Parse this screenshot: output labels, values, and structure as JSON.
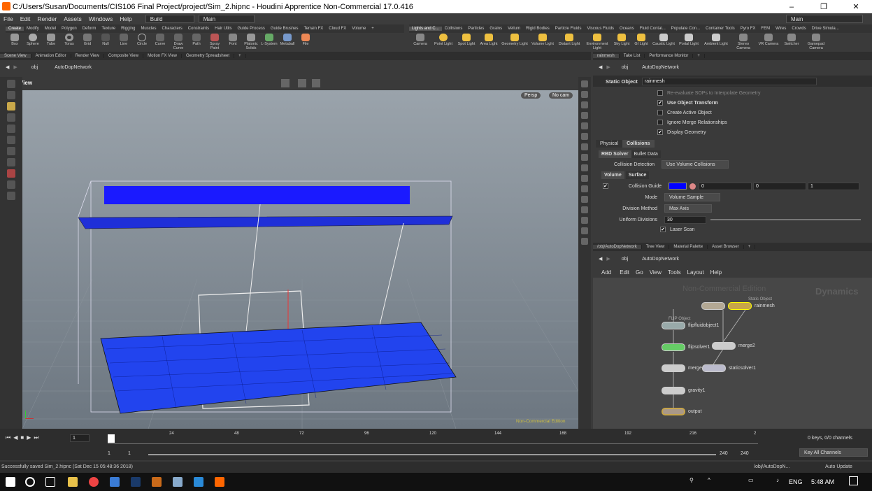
{
  "window": {
    "title": "C:/Users/Susan/Documents/CIS106 Final Project/project/Sim_2.hipnc - Houdini Apprentice Non-Commercial 17.0.416",
    "min": "–",
    "max": "❐",
    "close": "✕"
  },
  "menu": {
    "items": [
      "File",
      "Edit",
      "Render",
      "Assets",
      "Windows",
      "Help"
    ],
    "build": "Build",
    "main": "Main",
    "main_right": "Main"
  },
  "shelf_left": {
    "tabs": [
      "Create",
      "Modify",
      "Model",
      "Polygon",
      "Deform",
      "Texture",
      "Rigging",
      "Muscles",
      "Characters",
      "Constraints",
      "Hair Utils",
      "Guide Process",
      "Guide Brushes",
      "Terrain FX",
      "Cloud FX",
      "Volume"
    ],
    "tools": [
      "Box",
      "Sphere",
      "Tube",
      "Torus",
      "Grid",
      "Null",
      "Line",
      "Circle",
      "Curve",
      "Draw Curve",
      "Path",
      "Spray Paint",
      "Font",
      "Platonic Solids",
      "L-System",
      "Metaball",
      "File"
    ]
  },
  "shelf_right": {
    "tabs": [
      "Lights and C...",
      "Collisions",
      "Particles",
      "Grains",
      "Vellum",
      "Rigid Bodies",
      "Particle Fluids",
      "Viscous Fluids",
      "Oceans",
      "Fluid Contai...",
      "Populate Con...",
      "Container Tools",
      "Pyro FX",
      "FEM",
      "Wires",
      "Crowds",
      "Drive Simula..."
    ],
    "tools": [
      "Camera",
      "Point Light",
      "Spot Light",
      "Area Light",
      "Geometry Light",
      "Volume Light",
      "Distant Light",
      "Environment Light",
      "Sky Light",
      "GI Light",
      "Caustic Light",
      "Portal Light",
      "Ambient Light",
      "Stereo Camera",
      "VR Camera",
      "Switcher",
      "Gamepad Camera"
    ]
  },
  "left_tabs": [
    "Scene View",
    "Animation Editor",
    "Render View",
    "Composite View",
    "Motion FX View",
    "Geometry Spreadsheet"
  ],
  "right_tabs_top": [
    "rainmesh",
    "Take List",
    "Performance Monitor"
  ],
  "path": {
    "obj": "obj",
    "net": "AutoDopNetwork"
  },
  "viewport": {
    "label": "View",
    "persp": "Persp",
    "cam": "No cam",
    "watermark": "Non-Commercial Edition"
  },
  "params": {
    "type": "Static Object",
    "name": "rainmesh",
    "toggles": [
      {
        "label": "Re-evaluate SOPs to Interpolate Geometry",
        "on": false
      },
      {
        "label": "Use Object Transform",
        "on": true
      },
      {
        "label": "Create Active Object",
        "on": false
      },
      {
        "label": "Ignore Merge Relationships",
        "on": false
      },
      {
        "label": "Display Geometry",
        "on": true
      }
    ],
    "tabs": [
      "Physical",
      "Collisions"
    ],
    "subtabs": [
      "RBD Solver",
      "Bullet Data"
    ],
    "collision_detection_label": "Collision Detection",
    "collision_detection": "Use Volume Collisions",
    "vs_tabs": [
      "Volume",
      "Surface"
    ],
    "guide_label": "Collision Guide",
    "guide_values": [
      "0",
      "0",
      "1"
    ],
    "guide_color": "#0000ff",
    "mode_label": "Mode",
    "mode": "Volume Sample",
    "division_label": "Division Method",
    "division": "Max Axis",
    "uniform_label": "Uniform Divisions",
    "uniform": "30",
    "laser": "Laser Scan"
  },
  "net_tabs": [
    "/obj/AutoDopNetwork",
    "Tree View",
    "Material Palette",
    "Asset Browser"
  ],
  "net_menu": [
    "Add",
    "Edit",
    "Go",
    "View",
    "Tools",
    "Layout",
    "Help"
  ],
  "network": {
    "watermark": "Non-Commercial Edition",
    "context": "Dynamics",
    "nodes": [
      {
        "name": "rainmesh",
        "sub": "Static Object"
      },
      {
        "name": "flipfluidobject1",
        "sub": "FLIP Object"
      },
      {
        "name": "flipsolver1",
        "sub": ""
      },
      {
        "name": "merge2",
        "sub": ""
      },
      {
        "name": "merge1",
        "sub": ""
      },
      {
        "name": "staticsolver1",
        "sub": ""
      },
      {
        "name": "gravity1",
        "sub": ""
      },
      {
        "name": "output",
        "sub": ""
      }
    ]
  },
  "timeline": {
    "frame": "1",
    "ticks": [
      "24",
      "48",
      "72",
      "96",
      "120",
      "144",
      "168",
      "192",
      "216",
      "2"
    ],
    "start": "1",
    "start2": "1",
    "end": "240",
    "end2": "240",
    "keys": "0 keys, 0/0 channels",
    "keyall": "Key All Channels"
  },
  "status": {
    "msg": "Successfully saved Sim_2.hipnc (Sat Dec 15 05:48:36 2018)",
    "path": "/obj/AutoDopN...",
    "update": "Auto Update"
  },
  "taskbar": {
    "lang": "ENG",
    "time": "5:48 AM"
  }
}
